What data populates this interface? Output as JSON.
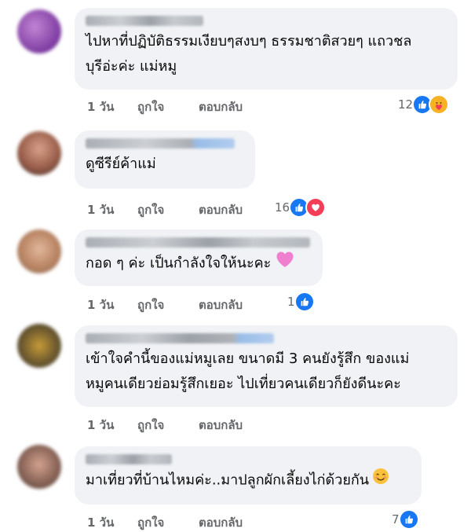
{
  "comments": [
    {
      "text": "ไปหาที่ปฏิบัติธรรมเงียบๆสงบๆ ธรรมชาติสวยๆ แถวชลบุรีอ่ะค่ะ แม่หมู",
      "line1": "ไปหาที่ปฏิบัติธรรมเงียบๆสงบๆ ธรรมชาติสวยๆ แถวชล",
      "line2": "บุรีอ่ะค่ะ แม่หมู",
      "time": "1 วัน",
      "like": "ถูกใจ",
      "reply": "ตอบกลับ",
      "reaction_count": "12",
      "reactions": [
        "like-icon",
        "care-icon"
      ]
    },
    {
      "text": "ดูซีรีย์ค้าแม่",
      "time": "1 วัน",
      "like": "ถูกใจ",
      "reply": "ตอบกลับ",
      "reaction_count": "16",
      "reactions": [
        "like-icon",
        "love-icon"
      ]
    },
    {
      "text": "กอด ๆ ค่ะ เป็นกำลังใจให้นะคะ",
      "emoji": "pink-heart-icon",
      "time": "1 วัน",
      "like": "ถูกใจ",
      "reply": "ตอบกลับ",
      "reaction_count": "1",
      "reactions": [
        "like-icon"
      ]
    },
    {
      "line1": "เข้าใจคำนี้ของแม่หมูเลย ขนาดมี 3 คนยังรู้สึก ของแม่",
      "line2": "หมูคนเดียวย่อมรู้สึกเยอะ ไปเที่ยวคนเดียวก็ยังดีนะคะ",
      "time": "1 วัน",
      "like": "ถูกใจ",
      "reply": "ตอบกลับ"
    },
    {
      "text": "มาเที่ยวที่บ้านไหมค่ะ..มาปลูกผักเลี้ยงไก่ด้วยกัน",
      "emoji": "smiling-face-icon",
      "time": "1 วัน",
      "like": "ถูกใจ",
      "reply": "ตอบกลับ",
      "reaction_count": "7",
      "reactions": [
        "like-icon"
      ]
    }
  ],
  "colors": {
    "like": "#1877f2",
    "love": "#f33e58",
    "care": "#f7b125",
    "bubble": "#f0f2f5",
    "meta": "#65676b"
  }
}
